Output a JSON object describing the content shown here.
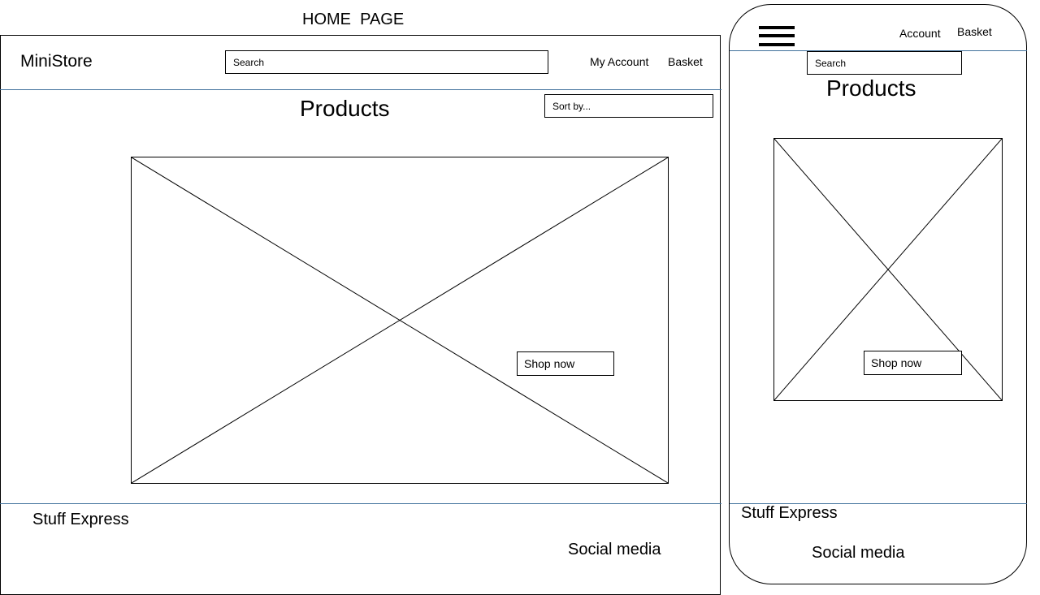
{
  "page_title": "HOME  PAGE",
  "desktop": {
    "logo": "MiniStore",
    "search_placeholder": "Search",
    "nav": {
      "account": "My Account",
      "basket": "Basket"
    },
    "products_title": "Products",
    "sort_placeholder": "Sort by...",
    "hero": {
      "icon": "image-placeholder-icon",
      "cta": "Shop now"
    },
    "footer": {
      "brand": "Stuff Express",
      "social": "Social media"
    }
  },
  "mobile": {
    "menu_icon": "hamburger-menu-icon",
    "nav": {
      "account": "Account",
      "basket": "Basket"
    },
    "search_placeholder": "Search",
    "products_title": "Products",
    "hero": {
      "icon": "image-placeholder-icon",
      "cta": "Shop now"
    },
    "footer": {
      "brand": "Stuff Express",
      "social": "Social media"
    }
  },
  "colors": {
    "divider": "#41719c",
    "outline": "#000000"
  }
}
